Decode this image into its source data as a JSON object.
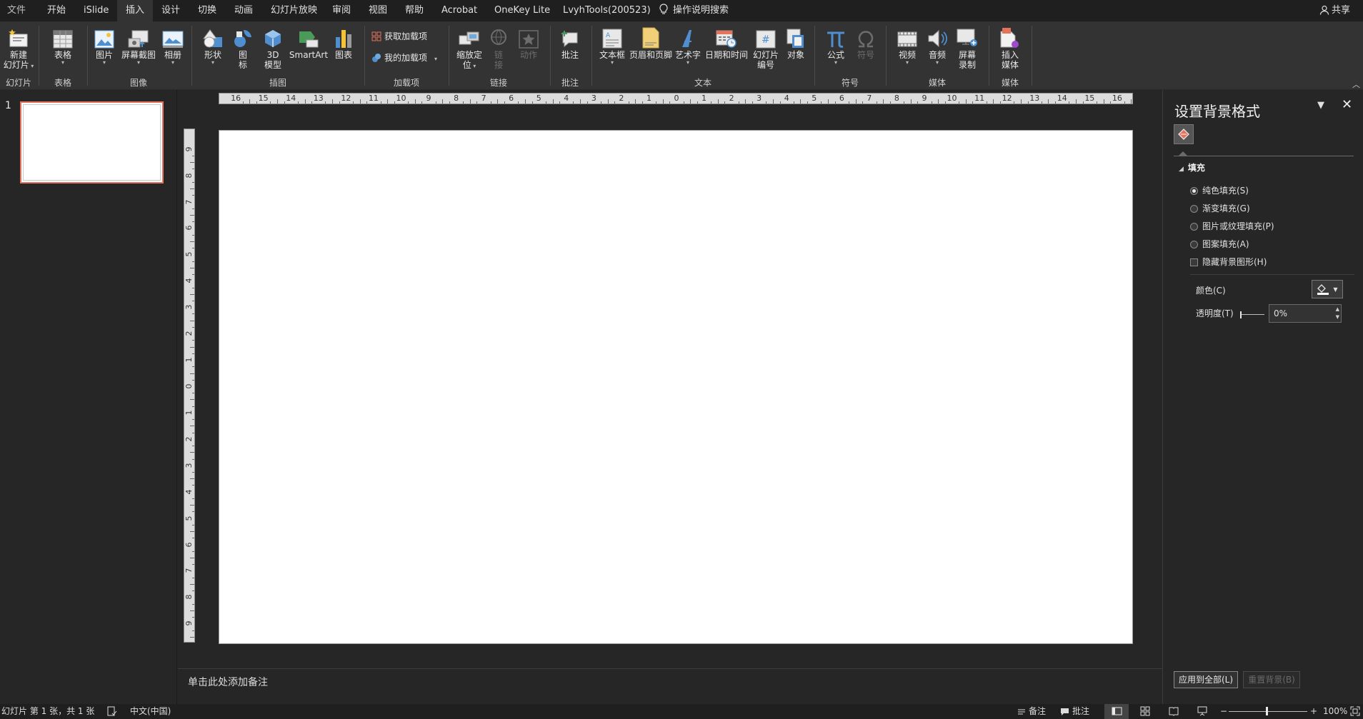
{
  "tabs": [
    "文件",
    "开始",
    "iSlide",
    "插入",
    "设计",
    "切换",
    "动画",
    "幻灯片放映",
    "审阅",
    "视图",
    "帮助",
    "Acrobat",
    "OneKey Lite",
    "LvyhTools(200523)"
  ],
  "active_tab": "插入",
  "tell_me": "操作说明搜索",
  "share": "共享",
  "ribbon": {
    "new_slide": {
      "line1": "新建",
      "line2": "幻灯片"
    },
    "table": "表格",
    "picture": "图片",
    "screenshot": "屏幕截图",
    "album": "相册",
    "shapes": "形状",
    "icons": {
      "line1": "图",
      "line2": "标"
    },
    "model3d": {
      "line1": "3D",
      "line2": "模型"
    },
    "smartart": "SmartArt",
    "chart": "图表",
    "get_addins": "获取加载项",
    "my_addins": "我的加载项",
    "zoom": {
      "line1": "缩放定",
      "line2": "位"
    },
    "link": {
      "line1": "链",
      "line2": "接"
    },
    "action": "动作",
    "comment": "批注",
    "textbox": "文本框",
    "header_footer": "页眉和页脚",
    "wordart": "艺术字",
    "datetime": "日期和时间",
    "slide_number": {
      "line1": "幻灯片",
      "line2": "编号"
    },
    "object": "对象",
    "equation": "公式",
    "symbol": "符号",
    "video": "视频",
    "audio": "音频",
    "screen_record": {
      "line1": "屏幕",
      "line2": "录制"
    },
    "insert_media": {
      "line1": "插入",
      "line2": "媒体"
    },
    "groups": {
      "slides": "幻灯片",
      "tables": "表格",
      "images": "图像",
      "illustrations": "插图",
      "addins": "加载项",
      "links": "链接",
      "comments": "批注",
      "text": "文本",
      "symbols": "符号",
      "media": "媒体",
      "media2": "媒体"
    }
  },
  "thumb_number": "1",
  "ruler_h": [
    "16",
    "15",
    "14",
    "13",
    "12",
    "11",
    "10",
    "9",
    "8",
    "7",
    "6",
    "5",
    "4",
    "3",
    "2",
    "1",
    "0",
    "1",
    "2",
    "3",
    "4",
    "5",
    "6",
    "7",
    "8",
    "9",
    "10",
    "11",
    "12",
    "13",
    "14",
    "15",
    "16"
  ],
  "ruler_v": [
    "9",
    "8",
    "7",
    "6",
    "5",
    "4",
    "3",
    "2",
    "1",
    "0",
    "1",
    "2",
    "3",
    "4",
    "5",
    "6",
    "7",
    "8",
    "9"
  ],
  "notes_placeholder": "单击此处添加备注",
  "pane": {
    "title": "设置背景格式",
    "section": "填充",
    "options": [
      {
        "label": "纯色填充(S)",
        "checked": true
      },
      {
        "label": "渐变填充(G)",
        "checked": false
      },
      {
        "label": "图片或纹理填充(P)",
        "checked": false
      },
      {
        "label": "图案填充(A)",
        "checked": false
      }
    ],
    "hide_bg": "隐藏背景图形(H)",
    "color_label": "颜色(C)",
    "transparency_label": "透明度(T)",
    "transparency_value": "0%",
    "transparency_fraction": 0,
    "apply_all": "应用到全部(L)",
    "reset": "重置背景(B)"
  },
  "status": {
    "slide_info": "幻灯片 第 1 张，共 1 张",
    "language": "中文(中国)",
    "notes": "备注",
    "comments": "批注",
    "zoom": "100%"
  },
  "colors": {
    "accent": "#e5735c",
    "ribbon_bg": "#333333",
    "window_bg": "#262626"
  }
}
